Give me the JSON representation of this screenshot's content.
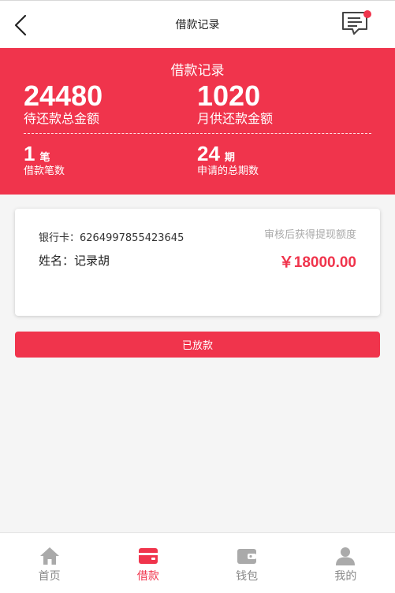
{
  "header": {
    "title": "借款记录",
    "back_icon": "chevron-left-icon",
    "message_icon": "message-list-icon"
  },
  "summary": {
    "title": "借款记录",
    "total_due_value": "24480",
    "total_due_label": "待还款总金额",
    "monthly_value": "1020",
    "monthly_label": "月供还款金额",
    "count_value": "1",
    "count_unit": "笔",
    "count_label": "借款笔数",
    "periods_value": "24",
    "periods_unit": "期",
    "periods_label": "申请的总期数"
  },
  "card": {
    "bank_label": "银行卡：",
    "bank_number": "6264997855423645",
    "hint": "审核后获得提现额度",
    "name_label": "姓名：",
    "name_value": "记录胡",
    "amount": "￥18000.00"
  },
  "status_button": {
    "label": "已放款"
  },
  "nav": {
    "items": [
      {
        "label": "首页",
        "icon": "home-icon",
        "active": false
      },
      {
        "label": "借款",
        "icon": "wallet-card-icon",
        "active": true
      },
      {
        "label": "钱包",
        "icon": "purse-icon",
        "active": false
      },
      {
        "label": "我的",
        "icon": "user-icon",
        "active": false
      }
    ]
  },
  "colors": {
    "accent": "#f0344c",
    "inactive": "#aaaaaa",
    "background": "#f5f5f5"
  }
}
